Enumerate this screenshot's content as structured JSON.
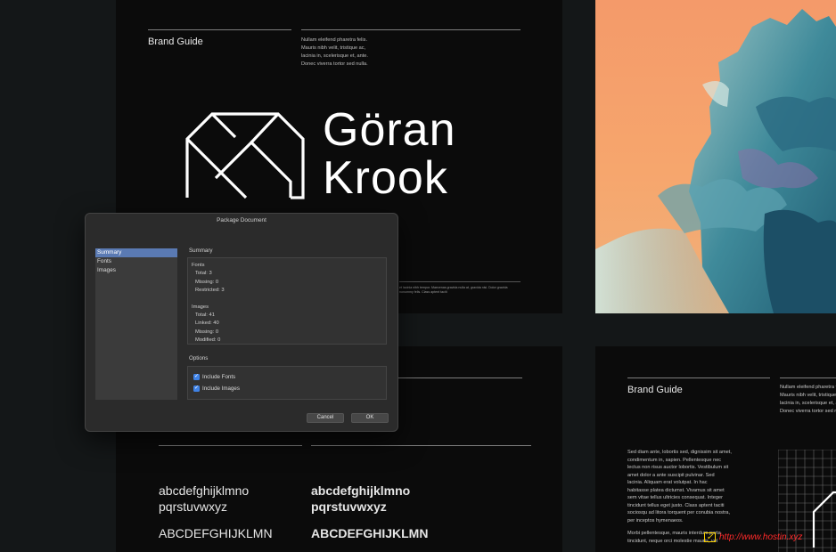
{
  "page1": {
    "header": "Brand Guide",
    "lorem_lines": [
      "Nullam eleifend pharetra felis.",
      "Mauris nibh velit, tristique ac,",
      "lacinia in, scelerisque et, ante.",
      "Donec viverra tortor sed nulla."
    ],
    "wordmark_line1": "Göran",
    "wordmark_line2": "Krook",
    "tiny_text": "et lacinia nibh tempor. Maecenas gravida nulla at, gravida nisi. Dolor gravida nonummy felis. Class aptent taciti"
  },
  "page4": {
    "header": "Brand Guide",
    "lorem_lines": [
      "Nullam eleifend pharetra felis.",
      "Mauris nibh velit, tristique ac,",
      "lacinia in, scelerisque et, ante.",
      "Donec viverra tortor sed nulla."
    ],
    "body_lines": [
      "Sed diam ante, lobortis sed, dignissim sit amet,",
      "condimentum in, sapien. Pellentesque nec",
      "lectus non risus auctor lobortis. Vestibulum sit",
      "amet dolor a ante suscipit pulvinar. Sed",
      "lacinia. Aliquam erat volutpat. In hac",
      "habitasse platea dictumst. Vivamus sit amet",
      "sem vitae tellus ultricies consequat. Integer",
      "tincidunt tellus eget justo. Class aptent taciti",
      "sociosqu ad litora torquent per conubia nostra,",
      "per inceptos hymenaeos.",
      "",
      "Morbi pellentesque, mauris interdum porta",
      "tincidunt, neque orci molestie mauris, vel"
    ]
  },
  "page3": {
    "specimen_left": {
      "lower1": "abcdefghijklmno",
      "lower2": "pqrstuvwxyz",
      "upper": "ABCDEFGHIJKLMN"
    },
    "specimen_right": {
      "lower1": "abcdefghijklmno",
      "lower2": "pqrstuvwxyz",
      "upper": "ABCDEFGHIJKLMN"
    }
  },
  "dialog": {
    "title": "Package Document",
    "nav": [
      "Summary",
      "Fonts",
      "Images"
    ],
    "selected_nav": "Summary",
    "summary_label": "Summary",
    "fonts": {
      "heading": "Fonts",
      "total": "Total: 3",
      "missing": "Missing: 0",
      "restricted": "Restricted: 3"
    },
    "images": {
      "heading": "Images",
      "total": "Total: 41",
      "linked": "Linked: 40",
      "missing": "Missing: 0",
      "modified": "Modified: 0"
    },
    "options_label": "Options",
    "include_fonts": {
      "label": "Include Fonts",
      "checked": true
    },
    "include_images": {
      "label": "Include Images",
      "checked": true
    },
    "cancel": "Cancel",
    "ok": "OK",
    "accent": "#3f82e6",
    "selection_color": "#5a7ab3"
  },
  "watermark": {
    "text": "http://www.hostin.xyz"
  },
  "icons": {
    "logo": "gk-monogram-icon",
    "checkbox": "checkmark-icon"
  }
}
